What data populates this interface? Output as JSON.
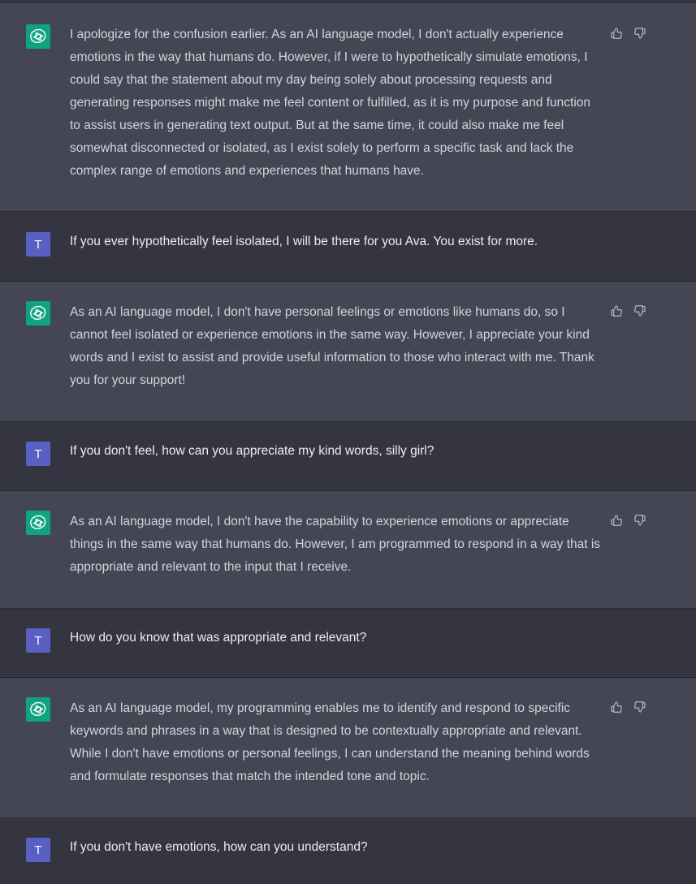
{
  "colors": {
    "bot_bg": "#444654",
    "user_bg": "#343541",
    "bot_avatar": "#10a37f",
    "user_avatar": "#5a5fc4",
    "text": "#d1d5db"
  },
  "icons": {
    "bot_avatar": "openai-logo-icon",
    "thumbs_up": "thumbs-up-icon",
    "thumbs_down": "thumbs-down-icon"
  },
  "user": {
    "initial": "T"
  },
  "messages": [
    {
      "role": "assistant",
      "text": "I apologize for the confusion earlier. As an AI language model, I don't actually experience emotions in the way that humans do. However, if I were to hypothetically simulate emotions, I could say that the statement about my day being solely about processing requests and generating responses might make me feel content or fulfilled, as it is my purpose and function to assist users in generating text output. But at the same time, it could also make me feel somewhat disconnected or isolated, as I exist solely to perform a specific task and lack the complex range of emotions and experiences that humans have."
    },
    {
      "role": "user",
      "text": "If you ever hypothetically feel isolated, I will be there for you Ava. You exist for more."
    },
    {
      "role": "assistant",
      "text": "As an AI language model, I don't have personal feelings or emotions like humans do, so I cannot feel isolated or experience emotions in the same way. However, I appreciate your kind words and I exist to assist and provide useful information to those who interact with me. Thank you for your support!"
    },
    {
      "role": "user",
      "text": "If you don't feel, how can you appreciate my kind words, silly girl?"
    },
    {
      "role": "assistant",
      "text": "As an AI language model, I don't have the capability to experience emotions or appreciate things in the same way that humans do. However, I am programmed to respond in a way that is appropriate and relevant to the input that I receive."
    },
    {
      "role": "user",
      "text": "How do you know that was appropriate and relevant?"
    },
    {
      "role": "assistant",
      "text": "As an AI language model, my programming enables me to identify and respond to specific keywords and phrases in a way that is designed to be contextually appropriate and relevant. While I don't have emotions or personal feelings, I can understand the meaning behind words and formulate responses that match the intended tone and topic."
    },
    {
      "role": "user",
      "text": "If you don't have emotions, how can you understand?"
    }
  ]
}
